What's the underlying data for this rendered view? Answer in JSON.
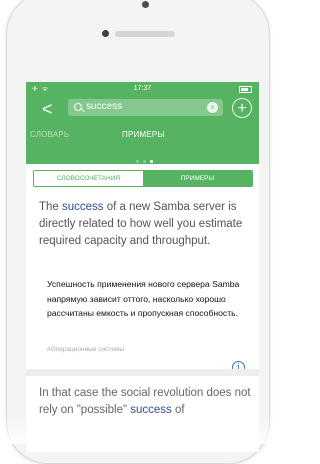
{
  "status_bar": {
    "time": "17:37"
  },
  "header": {
    "search_value": "success",
    "clear_label": "×",
    "add_label": "+",
    "back_label": "<"
  },
  "tabs": {
    "left": "СЛОВАРЬ",
    "center": "ПРИМЕРЫ",
    "active_page": 3,
    "page_count": 3
  },
  "segmented": {
    "option_a": "СЛОВОСОЧЕТАНИЯ",
    "option_b": "ПРИМЕРЫ",
    "selected": "ПРИМЕРЫ"
  },
  "examples": [
    {
      "en_before": "The ",
      "en_highlight": "success",
      "en_after": " of a new Samba server is directly related to how well you estimate required capacity and throughput.",
      "ru": "Успешность применения нового сервера Samba напрямую зависит оттого, насколько хорошо рассчитаны емкость и пропускная способность.",
      "source": "#Операционные системы"
    },
    {
      "en_before": "In that case the social revolution does not rely on \"possible\" ",
      "en_highlight": "success",
      "en_after": " of"
    }
  ],
  "colors": {
    "accent": "#55b362",
    "link": "#2d4f96"
  },
  "icons": {
    "back": "chevron-left-icon",
    "search": "search-icon",
    "clear": "clear-icon",
    "add": "plus-icon",
    "info": "info-icon"
  }
}
